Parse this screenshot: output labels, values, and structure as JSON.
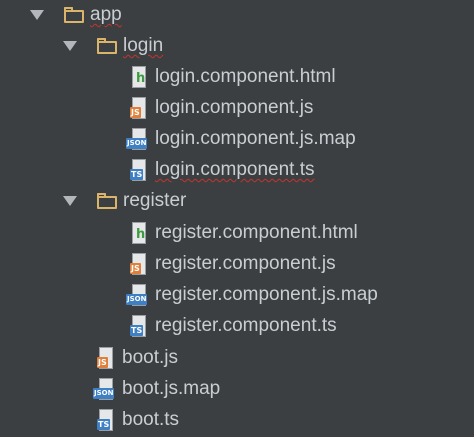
{
  "tree": {
    "root": {
      "label": "app",
      "icon": "folder-icon",
      "expanded": true
    },
    "login": {
      "label": "login",
      "icon": "folder-icon",
      "expanded": true,
      "files": [
        {
          "label": "login.component.html",
          "badge": "h",
          "type": "html"
        },
        {
          "label": "login.component.js",
          "badge": "JS",
          "type": "js"
        },
        {
          "label": "login.component.js.map",
          "badge": "JSON",
          "type": "json"
        },
        {
          "label": "login.component.ts",
          "badge": "TS",
          "type": "ts"
        }
      ]
    },
    "register": {
      "label": "register",
      "icon": "folder-icon",
      "expanded": true,
      "files": [
        {
          "label": "register.component.html",
          "badge": "h",
          "type": "html"
        },
        {
          "label": "register.component.js",
          "badge": "JS",
          "type": "js"
        },
        {
          "label": "register.component.js.map",
          "badge": "JSON",
          "type": "json"
        },
        {
          "label": "register.component.ts",
          "badge": "TS",
          "type": "ts"
        }
      ]
    },
    "root_files": [
      {
        "label": "boot.js",
        "badge": "JS",
        "type": "js"
      },
      {
        "label": "boot.js.map",
        "badge": "JSON",
        "type": "json"
      },
      {
        "label": "boot.ts",
        "badge": "TS",
        "type": "ts"
      }
    ]
  },
  "colors": {
    "background": "#3c3f41",
    "text": "#c9ced3",
    "folder": "#d9b46a",
    "js_badge": "#e07f3a",
    "ts_badge": "#3f7fc3",
    "html_badge": "#3f9b3f",
    "spellcheck": "#c4342d"
  }
}
